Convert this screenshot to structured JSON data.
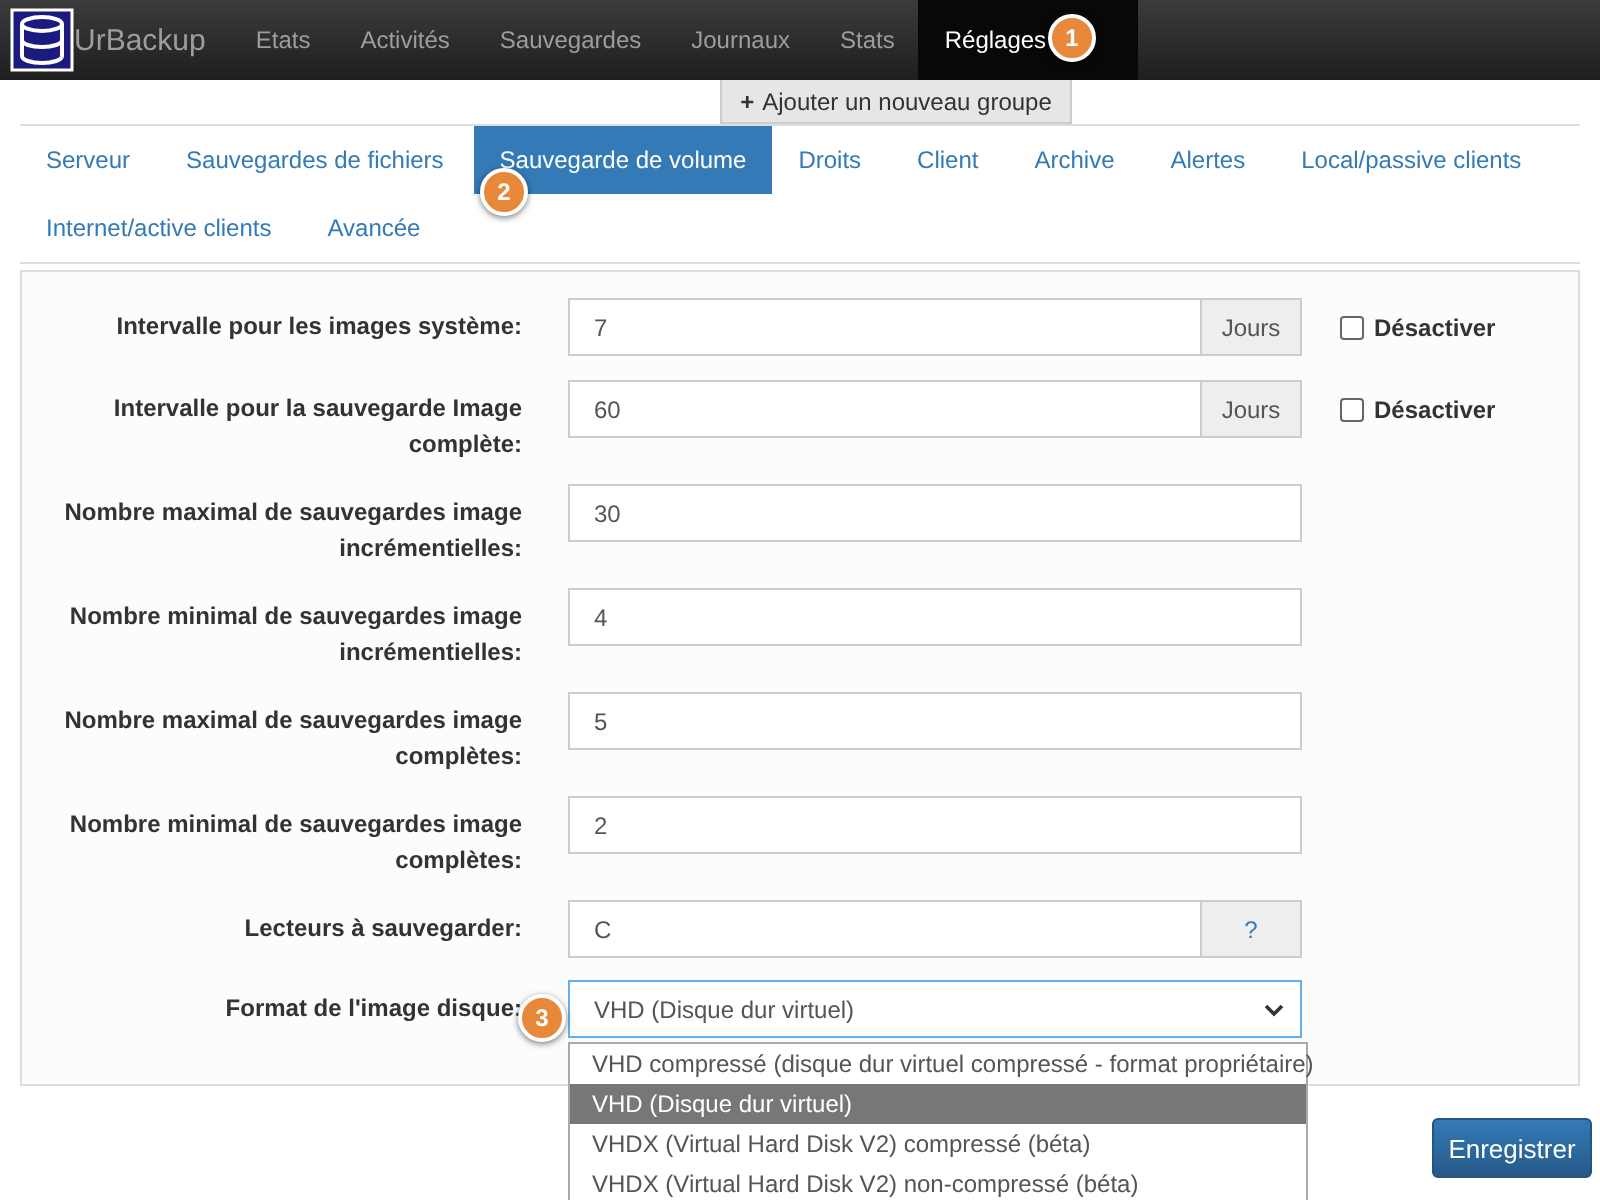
{
  "navbar": {
    "brand": "UrBackup",
    "items": [
      {
        "label": "Etats",
        "selected": false
      },
      {
        "label": "Activités",
        "selected": false
      },
      {
        "label": "Sauvegardes",
        "selected": false
      },
      {
        "label": "Journaux",
        "selected": false
      },
      {
        "label": "Stats",
        "selected": false
      },
      {
        "label": "Réglages",
        "selected": true
      }
    ]
  },
  "add_group_button": {
    "icon": "+",
    "label": "Ajouter un nouveau groupe"
  },
  "tabs": [
    {
      "label": "Serveur",
      "selected": false
    },
    {
      "label": "Sauvegardes de fichiers",
      "selected": false
    },
    {
      "label": "Sauvegarde de volume",
      "selected": true
    },
    {
      "label": "Droits",
      "selected": false
    },
    {
      "label": "Client",
      "selected": false
    },
    {
      "label": "Archive",
      "selected": false
    },
    {
      "label": "Alertes",
      "selected": false
    },
    {
      "label": "Local/passive clients",
      "selected": false
    },
    {
      "label": "Internet/active clients",
      "selected": false
    },
    {
      "label": "Avancée",
      "selected": false
    }
  ],
  "form": [
    {
      "kind": "addon-check",
      "label": "Intervalle pour les images système:",
      "value": "7",
      "addon": "Jours",
      "checkbox": {
        "label": "Désactiver",
        "checked": false
      }
    },
    {
      "kind": "addon-check",
      "label": "Intervalle pour la sauvegarde Image complète:",
      "value": "60",
      "addon": "Jours",
      "checkbox": {
        "label": "Désactiver",
        "checked": false
      }
    },
    {
      "kind": "text",
      "label": "Nombre maximal de sauvegardes image incrémentielles:",
      "value": "30"
    },
    {
      "kind": "text",
      "label": "Nombre minimal de sauvegardes image incrémentielles:",
      "value": "4"
    },
    {
      "kind": "text",
      "label": "Nombre maximal de sauvegardes image complètes:",
      "value": "5"
    },
    {
      "kind": "text",
      "label": "Nombre minimal de sauvegardes image complètes:",
      "value": "2"
    },
    {
      "kind": "help",
      "label": "Lecteurs à sauvegarder:",
      "value": "C",
      "addon": "?"
    },
    {
      "kind": "select",
      "label": "Format de l'image disque:",
      "value": "VHD (Disque dur virtuel)",
      "options": [
        {
          "label": "VHD compressé (disque dur virtuel compressé - format propriétaire)",
          "selected": false
        },
        {
          "label": "VHD (Disque dur virtuel)",
          "selected": true
        },
        {
          "label": "VHDX (Virtual Hard Disk V2) compressé (béta)",
          "selected": false
        },
        {
          "label": "VHDX (Virtual Hard Disk V2) non-compressé (béta)",
          "selected": false
        }
      ]
    }
  ],
  "save_button": "Enregistrer",
  "callouts": [
    "1",
    "2",
    "3"
  ]
}
